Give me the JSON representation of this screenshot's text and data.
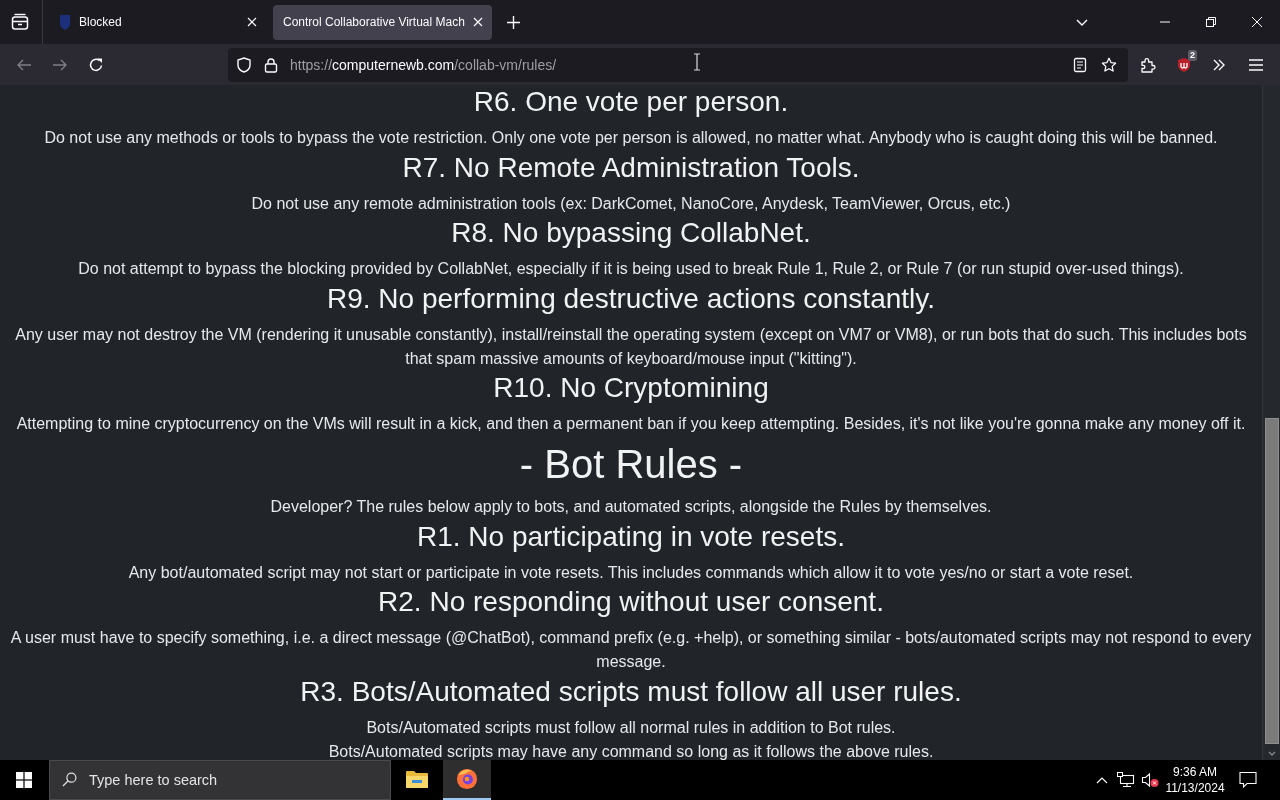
{
  "browser": {
    "tabs": [
      {
        "title": "Blocked",
        "favicon": true,
        "selected": false
      },
      {
        "title": "Control Collaborative Virtual Mach",
        "favicon": false,
        "selected": true
      }
    ],
    "nav": [
      {
        "kind": "back",
        "disabled": true
      },
      {
        "kind": "forward",
        "disabled": true
      },
      {
        "kind": "reload",
        "disabled": false
      }
    ],
    "address": {
      "scheme": "https://",
      "domain": "computernewb.com",
      "path": "/collab-vm/rules/"
    },
    "extension_badge": "2"
  },
  "page": {
    "sections": [
      {
        "kind": "rule",
        "heading": "R6. One vote per person.",
        "paragraphs": [
          "Do not use any methods or tools to bypass the vote restriction. Only one vote per person is allowed, no matter what. Anybody who is caught doing this will be banned."
        ]
      },
      {
        "kind": "rule",
        "heading": "R7. No Remote Administration Tools.",
        "paragraphs": [
          "Do not use any remote administration tools (ex: DarkComet, NanoCore, Anydesk, TeamViewer, Orcus, etc.)"
        ]
      },
      {
        "kind": "rule",
        "heading": "R8. No bypassing CollabNet.",
        "paragraphs": [
          "Do not attempt to bypass the blocking provided by CollabNet, especially if it is being used to break Rule 1, Rule 2, or Rule 7 (or run stupid over-used things)."
        ]
      },
      {
        "kind": "rule",
        "heading": "R9. No performing destructive actions constantly.",
        "paragraphs": [
          "Any user may not destroy the VM (rendering it unusable constantly), install/reinstall the operating system (except on VM7 or VM8), or run bots that do such. This includes bots that spam massive amounts of keyboard/mouse input (\"kitting\")."
        ]
      },
      {
        "kind": "rule",
        "heading": "R10. No Cryptomining",
        "paragraphs": [
          "Attempting to mine cryptocurrency on the VMs will result in a kick, and then a permanent ban if you keep attempting. Besides, it's not like you're gonna make any money off it."
        ]
      },
      {
        "kind": "section",
        "heading": "- Bot Rules -",
        "paragraphs": [
          "Developer? The rules below apply to bots, and automated scripts, alongside the Rules by themselves."
        ]
      },
      {
        "kind": "rule",
        "heading": "R1. No participating in vote resets.",
        "paragraphs": [
          "Any bot/automated script may not start or participate in vote resets. This includes commands which allow it to vote yes/no or start a vote reset."
        ]
      },
      {
        "kind": "rule",
        "heading": "R2. No responding without user consent.",
        "paragraphs": [
          "A user must have to specify something, i.e. a direct message (@ChatBot), command prefix (e.g. +help), or something similar - bots/automated scripts may not respond to every message."
        ]
      },
      {
        "kind": "rule",
        "heading": "R3. Bots/Automated scripts must follow all user rules.",
        "paragraphs": [
          "Bots/Automated scripts must follow all normal rules in addition to Bot rules.",
          "Bots/Automated scripts may have any command so long as it follows the above rules."
        ]
      }
    ]
  },
  "taskbar": {
    "search_placeholder": "Type here to search",
    "apps": [
      {
        "kind": "files",
        "selected": false
      },
      {
        "kind": "browser",
        "selected": true
      }
    ],
    "time": "9:36 AM",
    "date": "11/13/2024"
  }
}
